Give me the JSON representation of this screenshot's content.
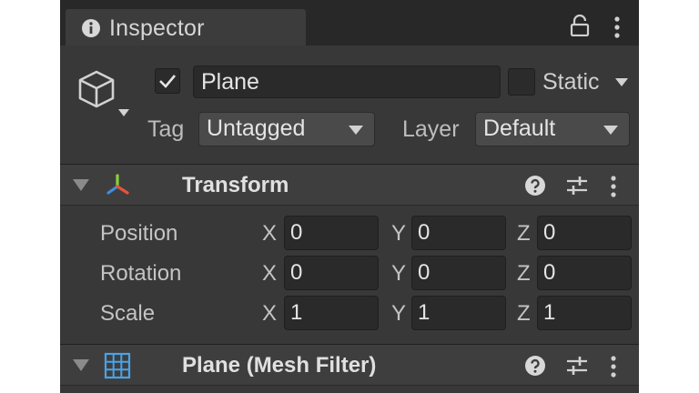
{
  "window": {
    "tab_title": "Inspector",
    "icons": [
      "info-icon",
      "lock-icon",
      "kebab-menu-icon"
    ]
  },
  "object": {
    "active": true,
    "name": "Plane",
    "static_label": "Static",
    "static_checked": false,
    "tag_label": "Tag",
    "tag_value": "Untagged",
    "layer_label": "Layer",
    "layer_value": "Default",
    "icon": "cube-icon"
  },
  "transform": {
    "title": "Transform",
    "icon": "transform-gizmo-icon",
    "rows": [
      {
        "label": "Position",
        "x": "0",
        "y": "0",
        "z": "0"
      },
      {
        "label": "Rotation",
        "x": "0",
        "y": "0",
        "z": "0"
      },
      {
        "label": "Scale",
        "x": "1",
        "y": "1",
        "z": "1"
      }
    ],
    "axes": {
      "x": "X",
      "y": "Y",
      "z": "Z"
    }
  },
  "mesh_filter": {
    "title": "Plane (Mesh Filter)",
    "icon": "mesh-grid-icon"
  },
  "colors": {
    "panel_bg": "#383838",
    "tabbar_bg": "#282828",
    "field_bg": "#2a2a2a",
    "dropdown_bg": "#4a4a4a",
    "text": "#e4e4e4",
    "gizmo_red": "#e5533c",
    "gizmo_green": "#8ccf3c",
    "gizmo_blue": "#3d8ee0",
    "mesh_icon_blue": "#4aa3e8"
  }
}
